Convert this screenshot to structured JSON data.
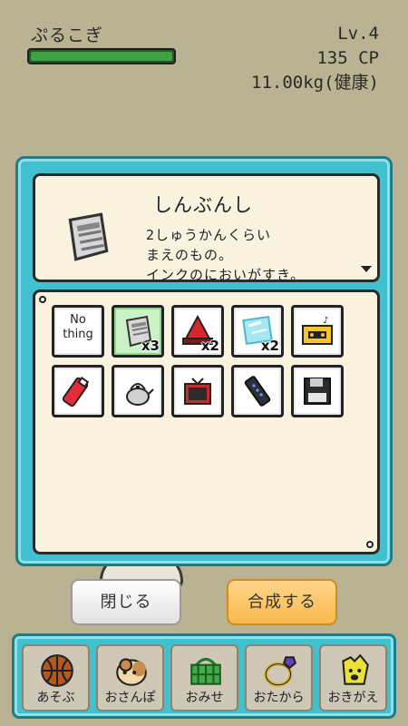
{
  "status": {
    "pet_name": "ぷるこぎ",
    "level": "Lv.4",
    "cp": "135 CP",
    "weight": "11.00kg(健康)",
    "hp_fraction": 1.0
  },
  "detail": {
    "title": "しんぶんし",
    "lines": [
      "2しゅうかんくらい",
      "まえのもの。",
      "インクのにおいがすき。"
    ]
  },
  "items": [
    {
      "icon": "nothing",
      "text": [
        "No",
        "thing"
      ],
      "count": ""
    },
    {
      "icon": "newspaper-icon",
      "count": "x3",
      "selected": true
    },
    {
      "icon": "red-cone-icon",
      "count": "x2"
    },
    {
      "icon": "ice-icon",
      "count": "x2"
    },
    {
      "icon": "cassette-tape-icon",
      "count": ""
    },
    {
      "icon": "red-tube-icon",
      "count": ""
    },
    {
      "icon": "kettle-icon",
      "count": ""
    },
    {
      "icon": "tv-icon",
      "count": ""
    },
    {
      "icon": "remote-control-icon",
      "count": ""
    },
    {
      "icon": "floppy-disk-icon",
      "count": ""
    }
  ],
  "buttons": {
    "close": "閉じる",
    "combine": "合成する"
  },
  "nav": [
    {
      "icon": "basketball-icon",
      "label": "あそぶ"
    },
    {
      "icon": "hamster-icon",
      "label": "おさんぽ"
    },
    {
      "icon": "basket-icon",
      "label": "おみせ"
    },
    {
      "icon": "ring-icon",
      "label": "おたから"
    },
    {
      "icon": "costume-icon",
      "label": "おきがえ"
    }
  ]
}
